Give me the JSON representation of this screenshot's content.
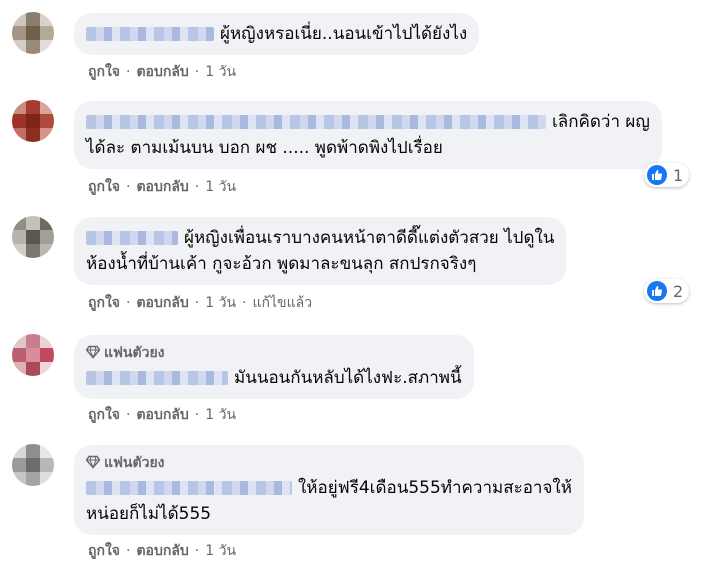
{
  "actions": {
    "like": "ถูกใจ",
    "reply": "ตอบกลับ",
    "separator": "·"
  },
  "colors": {
    "bubble": "#f0f2f5",
    "meta_text": "#65676b",
    "like_blue": "#1877f2"
  },
  "comments": [
    {
      "badge": "",
      "lines": [
        "ผู้หญิงหรอเนี่ย..นอนเข้าไปได้ยังไง"
      ],
      "time": "1 วัน",
      "edited": "",
      "reactions": null
    },
    {
      "badge": "",
      "lines": [
        "เลิกคิดว่า ผญ",
        "ได้ละ ตามเม้นบน บอก ผช ..... พูดพ้าดพิงไปเรื่อย"
      ],
      "time": "1 วัน",
      "edited": "",
      "reactions": "1"
    },
    {
      "badge": "",
      "lines": [
        "ผู้หญิงเพื่อนเราบางคนหน้าตาดีดี๊แต่งตัวสวย ไปดูใน",
        "ห้องน้ำที่บ้านเค้า กูจะอ้วก พูดมาละขนลุก สกปรกจริงๆ"
      ],
      "time": "1 วัน",
      "edited": "แก้ไขแล้ว",
      "reactions": "2"
    },
    {
      "badge": "แฟนตัวยง",
      "badge_icon": "diamond-icon",
      "lines": [
        "มันนอนกันหลับได้ไงฟะ.สภาพนี้"
      ],
      "time": "1 วัน",
      "edited": "",
      "reactions": null
    },
    {
      "badge": "แฟนตัวยง",
      "badge_icon": "diamond-icon",
      "lines": [
        "ให้อยู่ฟรี4เดือน555ทำความสะอาจให้",
        "หน่อยก็ไม่ได้555"
      ],
      "time": "1 วัน",
      "edited": "",
      "reactions": null
    }
  ]
}
